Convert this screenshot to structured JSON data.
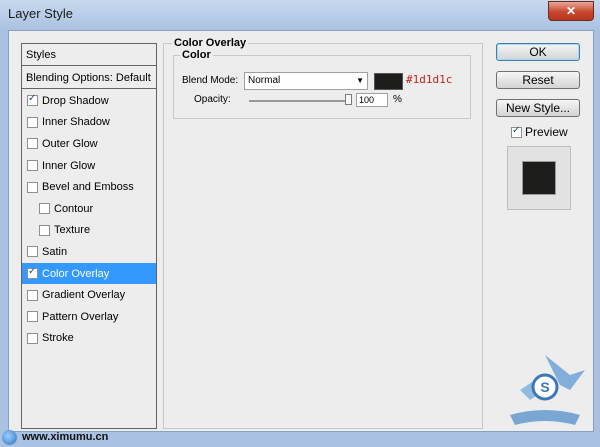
{
  "window": {
    "title": "Layer Style",
    "close_glyph": "✕"
  },
  "styles_panel": {
    "header": "Styles",
    "blending": "Blending Options: Default",
    "items": [
      {
        "label": "Drop Shadow",
        "checked": true,
        "indent": false,
        "selected": false
      },
      {
        "label": "Inner Shadow",
        "checked": false,
        "indent": false,
        "selected": false
      },
      {
        "label": "Outer Glow",
        "checked": false,
        "indent": false,
        "selected": false
      },
      {
        "label": "Inner Glow",
        "checked": false,
        "indent": false,
        "selected": false
      },
      {
        "label": "Bevel and Emboss",
        "checked": false,
        "indent": false,
        "selected": false
      },
      {
        "label": "Contour",
        "checked": false,
        "indent": true,
        "selected": false
      },
      {
        "label": "Texture",
        "checked": false,
        "indent": true,
        "selected": false
      },
      {
        "label": "Satin",
        "checked": false,
        "indent": false,
        "selected": false
      },
      {
        "label": "Color Overlay",
        "checked": true,
        "indent": false,
        "selected": true
      },
      {
        "label": "Gradient Overlay",
        "checked": false,
        "indent": false,
        "selected": false
      },
      {
        "label": "Pattern Overlay",
        "checked": false,
        "indent": false,
        "selected": false
      },
      {
        "label": "Stroke",
        "checked": false,
        "indent": false,
        "selected": false
      }
    ]
  },
  "color_overlay": {
    "title": "Color Overlay",
    "color_group_title": "Color",
    "blend_mode_label": "Blend Mode:",
    "blend_mode_value": "Normal",
    "swatch_color": "#1d1d1c",
    "hex_annotation": "#1d1d1c",
    "opacity_label": "Opacity:",
    "opacity_value": "100",
    "opacity_unit": "%"
  },
  "buttons": {
    "ok": "OK",
    "reset": "Reset",
    "new_style": "New Style...",
    "preview_label": "Preview",
    "preview_checked": true
  },
  "footer": {
    "url": "www.ximumu.cn"
  }
}
